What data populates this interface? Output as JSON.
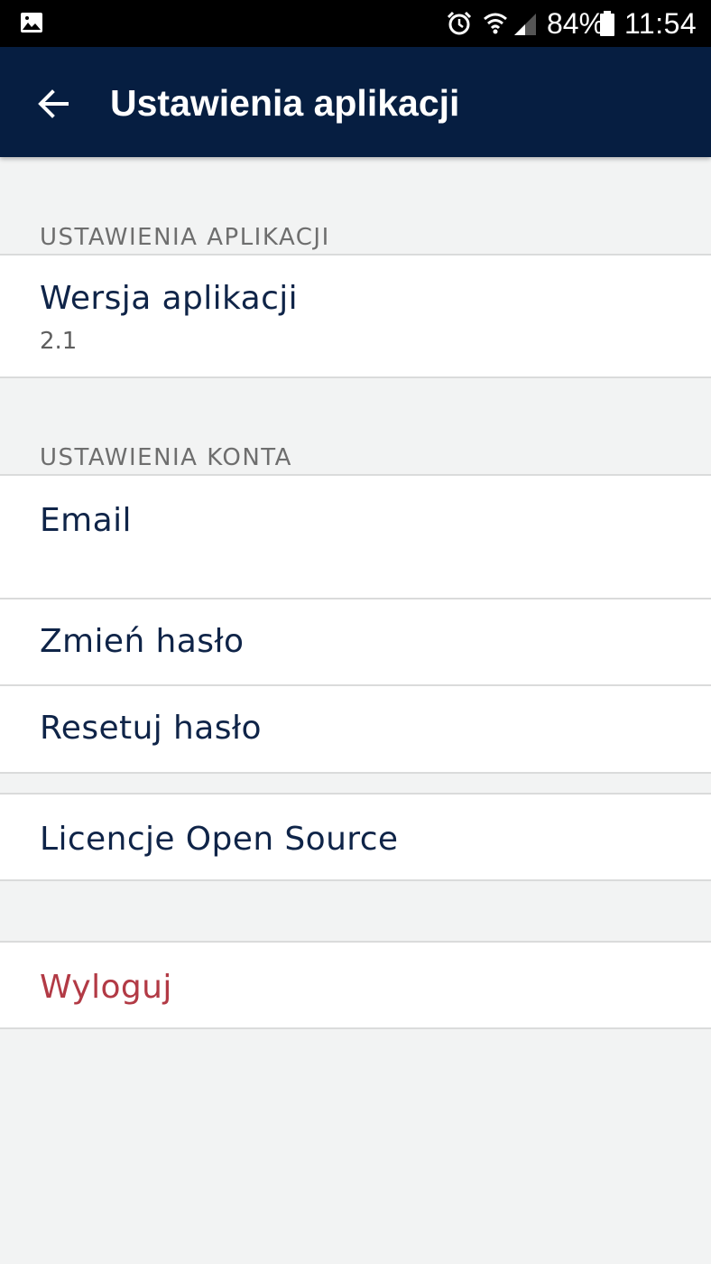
{
  "status_bar": {
    "battery_percent": "84%",
    "time": "11:54",
    "icons": [
      "gallery-icon",
      "alarm-icon",
      "wifi-icon",
      "signal-icon",
      "battery-icon"
    ]
  },
  "app_bar": {
    "title": "Ustawienia aplikacji",
    "back_icon": "arrow-left-icon",
    "background_color": "#061e41"
  },
  "sections": {
    "app_settings": {
      "header": "USTAWIENIA APLIKACJI",
      "version_title": "Wersja aplikacji",
      "version_value": "2.1"
    },
    "account_settings": {
      "header": "USTAWIENIA KONTA",
      "email": "Email",
      "change_password": "Zmień hasło",
      "reset_password": "Resetuj hasło"
    },
    "licenses": "Licencje Open Source",
    "logout": "Wyloguj"
  },
  "colors": {
    "logout_text": "#b23a45",
    "row_text": "#0f2448",
    "page_background": "#f2f3f3"
  }
}
